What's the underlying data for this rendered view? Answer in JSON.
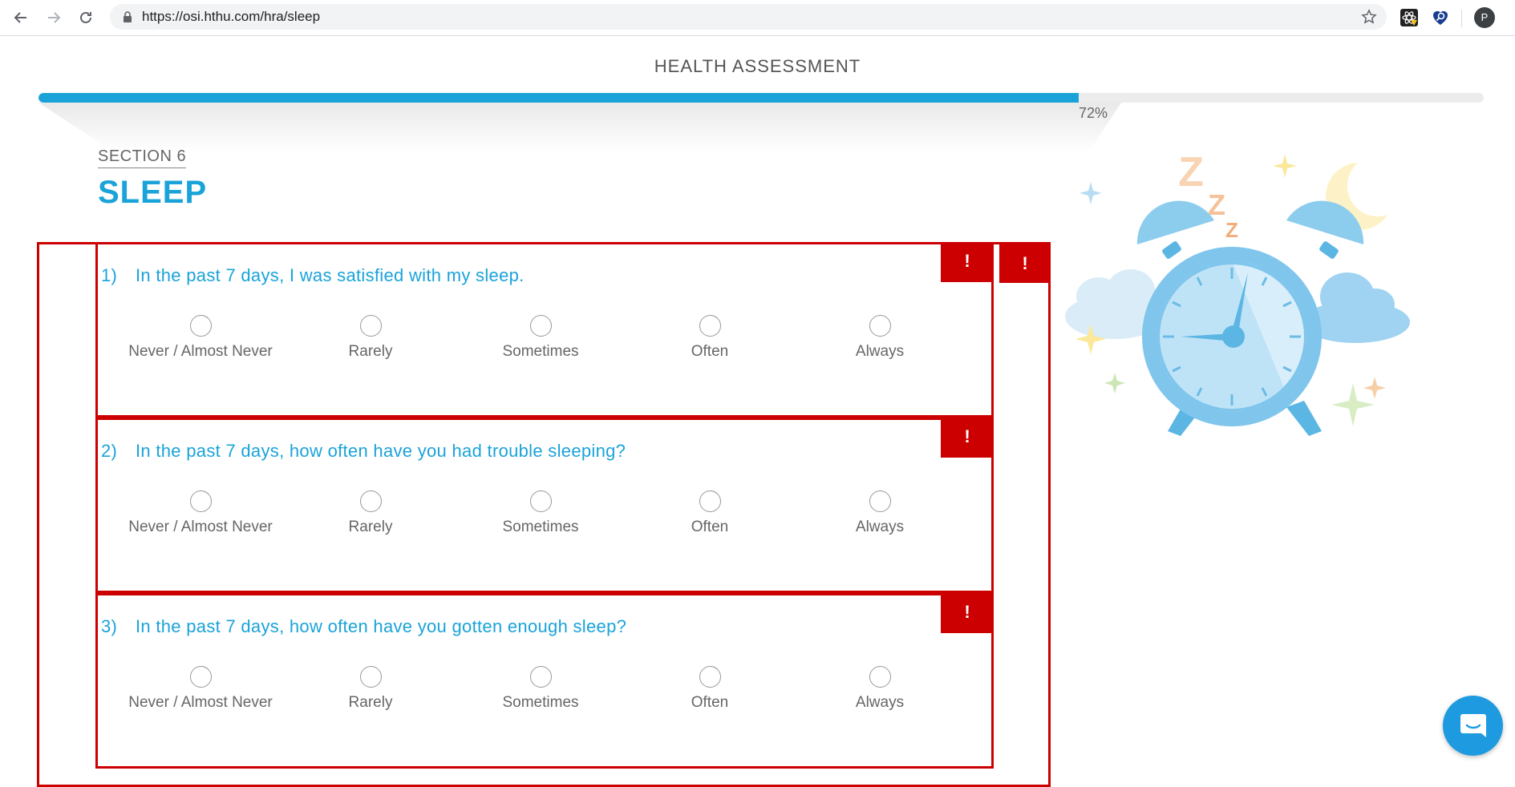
{
  "browser": {
    "url": "https://osi.hthu.com/hra/sleep",
    "profile_initial": "P"
  },
  "header": {
    "title": "HEALTH ASSESSMENT",
    "progress": 0.72,
    "progress_label": "72%"
  },
  "section": {
    "label": "SECTION 6",
    "title": "SLEEP"
  },
  "error_marker": "!",
  "options": [
    "Never / Almost Never",
    "Rarely",
    "Sometimes",
    "Often",
    "Always"
  ],
  "questions": [
    {
      "number": "1)",
      "text": "In the past 7 days, I was satisfied with my sleep."
    },
    {
      "number": "2)",
      "text": "In the past 7 days, how often have you had trouble sleeping?"
    },
    {
      "number": "3)",
      "text": "In the past 7 days, how often have you gotten enough sleep?"
    }
  ],
  "colors": {
    "accent": "#1aa3d9",
    "error": "#cc0000",
    "chat": "#1e9be0"
  },
  "icons": {
    "back": "arrow-left",
    "forward": "arrow-right",
    "reload": "reload",
    "lock": "lock",
    "bookmark": "star",
    "chat": "chat-bubble",
    "illustration": "alarm-clock-with-clouds-moon-stars"
  }
}
